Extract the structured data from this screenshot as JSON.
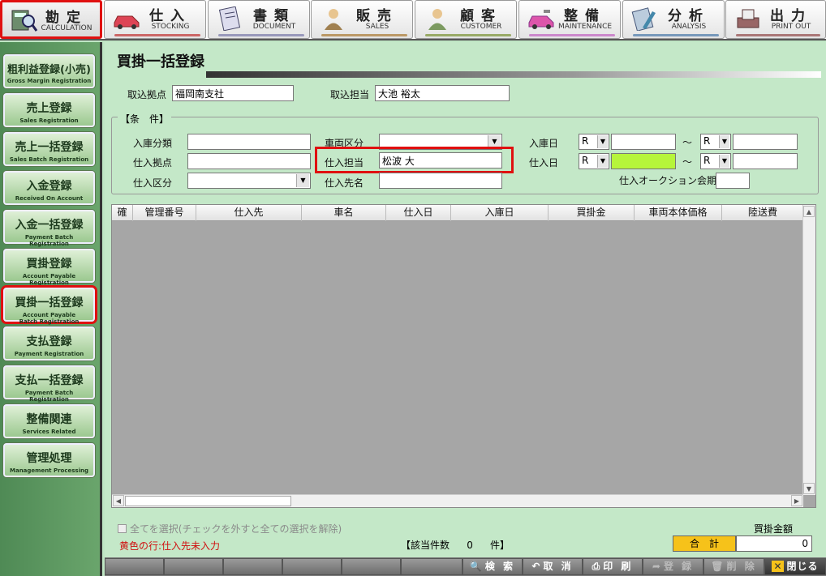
{
  "nav": [
    {
      "jp": "勘定",
      "en": "CALCULATION",
      "icon": "calculator-search-icon",
      "active": true
    },
    {
      "jp": "仕入",
      "en": "STOCKING",
      "icon": "car-icon",
      "active": false
    },
    {
      "jp": "書類",
      "en": "DOCUMENT",
      "icon": "document-icon",
      "active": false
    },
    {
      "jp": "販売",
      "en": "SALES",
      "icon": "salesperson-icon",
      "active": false
    },
    {
      "jp": "顧客",
      "en": "CUSTOMER",
      "icon": "customer-icon",
      "active": false
    },
    {
      "jp": "整備",
      "en": "MAINTENANCE",
      "icon": "maintenance-car-icon",
      "active": false
    },
    {
      "jp": "分析",
      "en": "ANALYSIS",
      "icon": "analysis-icon",
      "active": false
    },
    {
      "jp": "出力",
      "en": "PRINT OUT",
      "icon": "printer-icon",
      "active": false
    }
  ],
  "sidebar": [
    {
      "jp": "粗利益登録(小売)",
      "en": "Gross Margin Registration",
      "active": false
    },
    {
      "jp": "売上登録",
      "en": "Sales Registration",
      "active": false
    },
    {
      "jp": "売上一括登録",
      "en": "Sales Batch Registration",
      "active": false
    },
    {
      "jp": "入金登録",
      "en": "Received On Account",
      "active": false
    },
    {
      "jp": "入金一括登録",
      "en": "Payment Batch Registration",
      "active": false
    },
    {
      "jp": "買掛登録",
      "en": "Account Payable Registration",
      "active": false
    },
    {
      "jp": "買掛一括登録",
      "en": "Account Payable Batch Registration",
      "active": true
    },
    {
      "jp": "支払登録",
      "en": "Payment Registration",
      "active": false
    },
    {
      "jp": "支払一括登録",
      "en": "Payment Batch Registration",
      "active": false
    },
    {
      "jp": "整備関連",
      "en": "Services Related",
      "active": false
    },
    {
      "jp": "管理処理",
      "en": "Management Processing",
      "active": false
    }
  ],
  "page": {
    "title": "買掛一括登録",
    "branch_label": "取込拠点",
    "branch_value": "福岡南支社",
    "staff_label": "取込担当",
    "staff_value": "大池 裕太"
  },
  "conditions": {
    "legend": "【条　件】",
    "stock_category_label": "入庫分類",
    "stock_category_value": "",
    "purchase_branch_label": "仕入拠点",
    "purchase_branch_value": "",
    "purchase_type_label": "仕入区分",
    "purchase_type_value": "",
    "vehicle_type_label": "車両区分",
    "vehicle_type_value": "",
    "purchaser_label": "仕入担当",
    "purchaser_value": "松波 大",
    "supplier_label": "仕入先名",
    "supplier_value": "",
    "stock_date_label": "入庫日",
    "stock_date_era_from": "R",
    "stock_date_from": "",
    "stock_date_era_to": "R",
    "stock_date_to": "",
    "purchase_date_label": "仕入日",
    "purchase_date_era_from": "R",
    "purchase_date_from": "",
    "purchase_date_era_to": "R",
    "purchase_date_to": "",
    "range_sep": "〜",
    "auction_label": "仕入オークション会期",
    "auction_value": "",
    "highlight_color": "#b6f53a"
  },
  "grid": {
    "columns": [
      "確",
      "管理番号",
      "仕入先",
      "車名",
      "仕入日",
      "入庫日",
      "買掛金",
      "車両本体価格",
      "陸送費"
    ],
    "rows": []
  },
  "bottom": {
    "select_all": "全てを選択(チェックを外すと全ての選択を解除)",
    "yellow_note": "黄色の行:仕入先未入力",
    "count_label": "【該当件数",
    "count_value": "0",
    "count_unit": "件】",
    "amount_label": "買掛金額",
    "total_label": "合　計",
    "total_value": "0"
  },
  "footer": {
    "search": "検 索",
    "cancel": "取 消",
    "print": "印 刷",
    "register": "登 録",
    "delete": "削 除",
    "close": "閉じる"
  }
}
